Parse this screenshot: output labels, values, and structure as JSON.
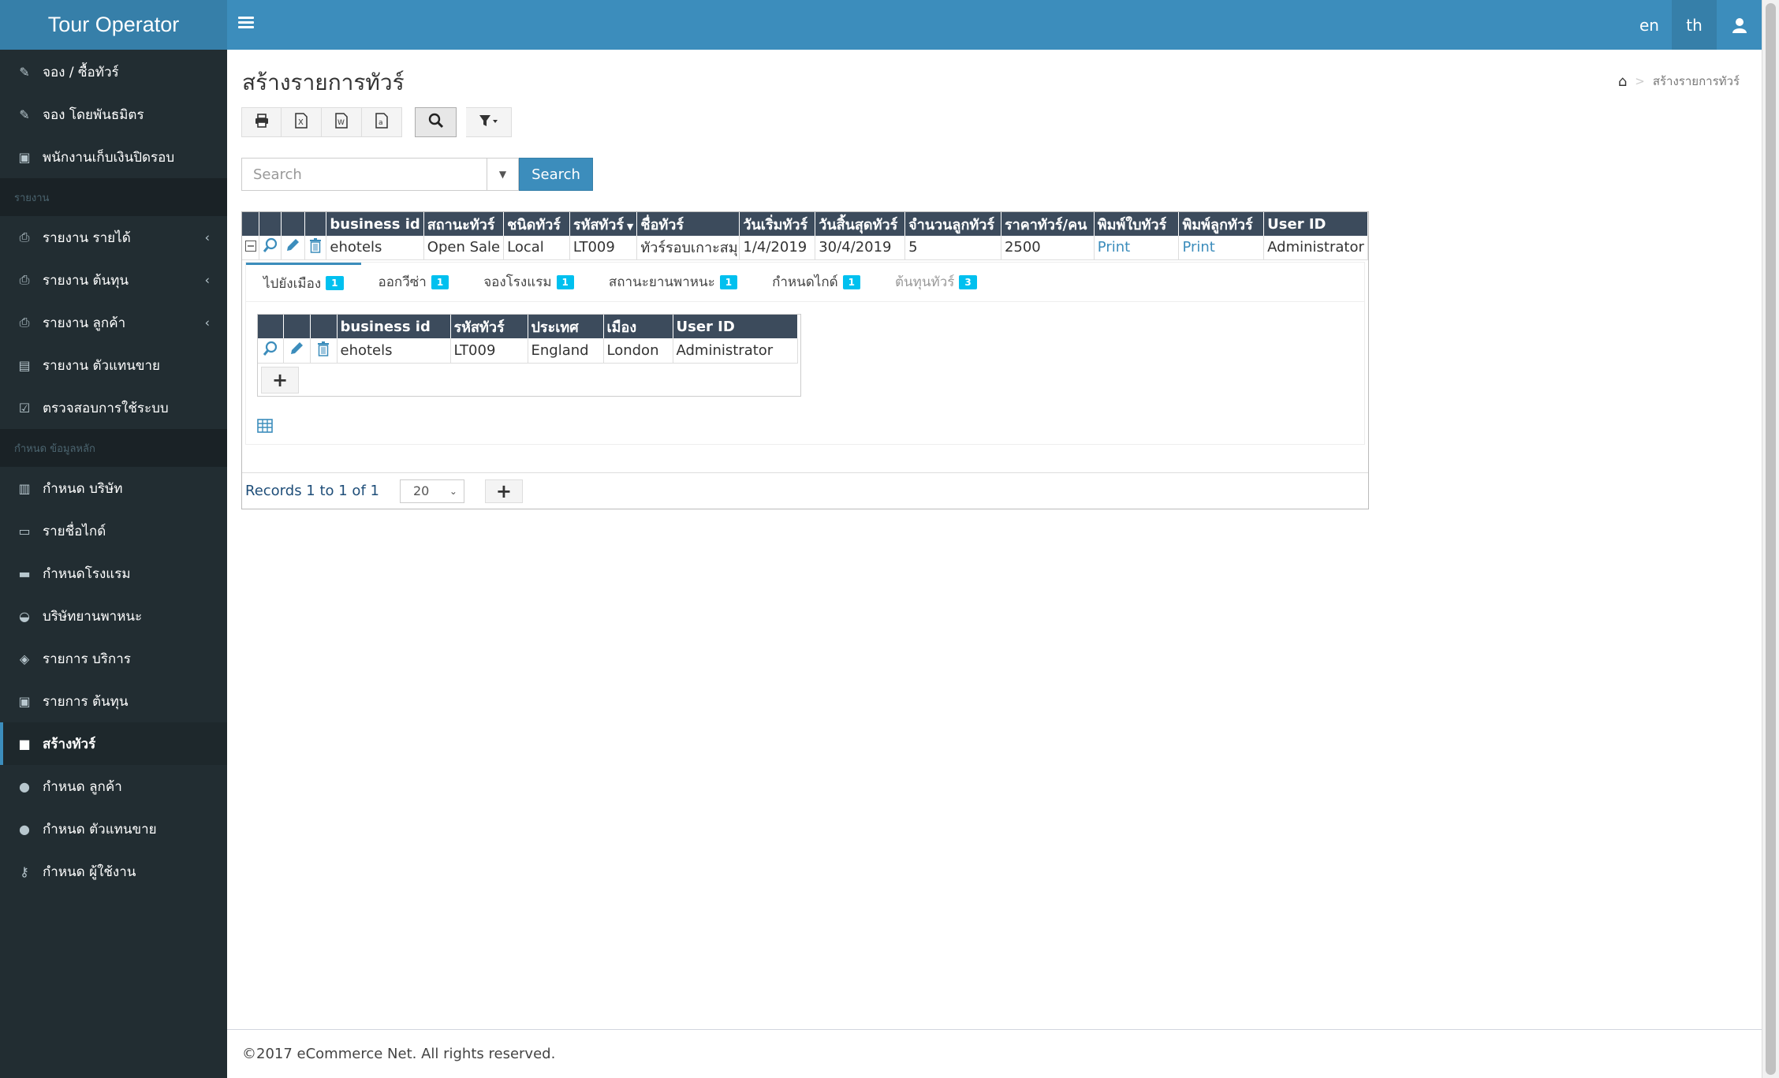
{
  "brand": "Tour Operator",
  "top": {
    "lang_en": "en",
    "lang_th": "th"
  },
  "sidebar": {
    "items": [
      {
        "label": "จอง / ซื้อทัวร์",
        "icon": "edit-icon"
      },
      {
        "label": "จอง โดยพันธมิตร",
        "icon": "edit-icon"
      },
      {
        "label": "พนักงานเก็บเงินปิดรอบ",
        "icon": "money-icon"
      }
    ],
    "header1": "รายงาน",
    "reports": [
      {
        "label": "รายงาน รายได้",
        "icon": "print-icon"
      },
      {
        "label": "รายงาน ต้นทุน",
        "icon": "print-icon"
      },
      {
        "label": "รายงาน ลูกค้า",
        "icon": "print-icon"
      },
      {
        "label": "รายงาน ตัวแทนขาย",
        "icon": "file-icon"
      },
      {
        "label": "ตรวจสอบการใช้ระบบ",
        "icon": "check-icon"
      }
    ],
    "header2": "กำหนด ข้อมูลหลัก",
    "master": [
      {
        "label": "กำหนด บริษัท",
        "icon": "building-icon"
      },
      {
        "label": "รายชื่อไกด์",
        "icon": "id-card-icon"
      },
      {
        "label": "กำหนดโรงแรม",
        "icon": "bed-icon"
      },
      {
        "label": "บริษัทยานพาหนะ",
        "icon": "car-icon"
      },
      {
        "label": "รายการ บริการ",
        "icon": "cubes-icon"
      },
      {
        "label": "รายการ ต้นทุน",
        "icon": "money-icon"
      },
      {
        "label": "สร้างทัวร์",
        "icon": "suitcase-icon"
      },
      {
        "label": "กำหนด ลูกค้า",
        "icon": "users-icon"
      },
      {
        "label": "กำหนด ตัวแทนขาย",
        "icon": "users-icon"
      },
      {
        "label": "กำหนด ผู้ใช้งาน",
        "icon": "key-icon"
      }
    ]
  },
  "page": {
    "title": "สร้างรายการทัวร์",
    "breadcrumb": "สร้างรายการทัวร์"
  },
  "search": {
    "placeholder": "Search",
    "button": "Search"
  },
  "grid": {
    "columns": [
      "business id",
      "สถานะทัวร์",
      "ชนิดทัวร์",
      "รหัสทัวร์",
      "ชื่อทัวร์",
      "วันเริ่มทัวร์",
      "วันสิ้นสุดทัวร์",
      "จำนวนลูกทัวร์",
      "ราคาทัวร์/คน",
      "พิมพ์ใบทัวร์",
      "พิมพ์ลูกทัวร์",
      "User ID"
    ],
    "row": [
      "ehotels",
      "Open Sale",
      "Local",
      "LT009",
      "ทัวร์รอบเกาะสมุย",
      "1/4/2019",
      "30/4/2019",
      "5",
      "2500",
      "Print",
      "Print",
      "Administrator"
    ]
  },
  "tabs": [
    {
      "label": "ไปยังเมือง",
      "count": "1"
    },
    {
      "label": "ออกวีซ่า",
      "count": "1"
    },
    {
      "label": "จองโรงแรม",
      "count": "1"
    },
    {
      "label": "สถานะยานพาหนะ",
      "count": "1"
    },
    {
      "label": "กำหนดไกด์",
      "count": "1"
    },
    {
      "label": "ต้นทุนทัวร์",
      "count": "3"
    }
  ],
  "subgrid": {
    "columns": [
      "business id",
      "รหัสทัวร์",
      "ประเทศ",
      "เมือง",
      "User ID"
    ],
    "row": [
      "ehotels",
      "LT009",
      "England",
      "London",
      "Administrator"
    ]
  },
  "pager": {
    "records": "Records 1 to 1 of 1",
    "page_size": "20"
  },
  "footer": "©2017 eCommerce Net. All rights reserved."
}
